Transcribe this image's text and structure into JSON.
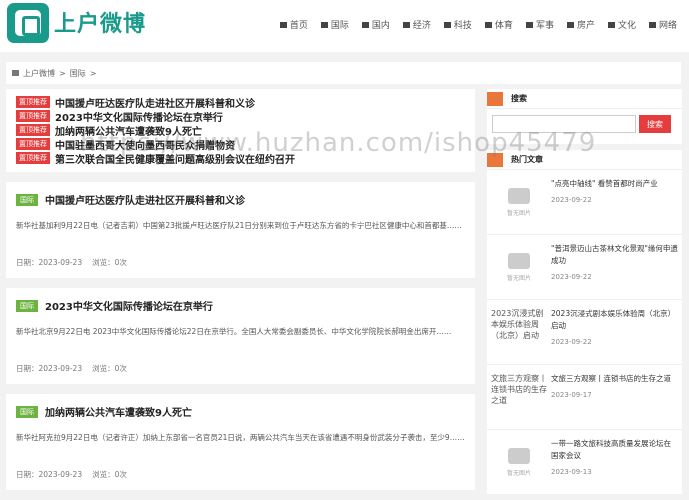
{
  "site": {
    "logo_text": "上户微博"
  },
  "nav": [
    "首页",
    "国际",
    "国内",
    "经济",
    "科技",
    "体育",
    "军事",
    "房产",
    "文化",
    "网络"
  ],
  "breadcrumb": [
    "上户微博",
    ">",
    "国际",
    ">"
  ],
  "hot": {
    "badge": "置顶推荐",
    "items": [
      "中国援卢旺达医疗队走进社区开展科普和义诊",
      "2023中华文化国际传播论坛在京举行",
      "加纳两辆公共汽车遭袭致9人死亡",
      "中国驻墨西哥大使向墨西哥民众捐赠物资",
      "第三次联合国全民健康覆盖问题高级别会议在纽约召开"
    ]
  },
  "posts": [
    {
      "badge": "国际",
      "title": "中国援卢旺达医疗队走进社区开展科普和义诊",
      "excerpt": "新华社基加利9月22日电（记者吉莉）中国第23批援卢旺达医疗队21日分别来到位于卢旺达东方省的卡宁巴社区健康中心和首都基……",
      "date": "日期：2023-09-23",
      "views": "浏览：0次"
    },
    {
      "badge": "国际",
      "title": "2023中华文化国际传播论坛在京举行",
      "excerpt": "新华社北京9月22日电 2023中华文化国际传播论坛22日在京举行。全国人大常委会副委员长、中华文化学院院长郝明金出席开……",
      "date": "日期：2023-09-23",
      "views": "浏览：0次"
    },
    {
      "badge": "国际",
      "title": "加纳两辆公共汽车遭袭致9人死亡",
      "excerpt": "新华社阿克拉9月22日电（记者许正）加纳上东部省一名官员21日说，两辆公共汽车当天在该省遭遇不明身份武装分子袭击，至少9……",
      "date": "日期：2023-09-23",
      "views": "浏览：0次"
    }
  ],
  "sidebar": {
    "search_title": "搜索",
    "search_btn": "搜索",
    "hot_title": "热门文章",
    "no_img": "暂无图片",
    "articles": [
      {
        "title": "\"点亮中轴线\" 看赞首都时尚产业",
        "date": "2023-09-22",
        "thumb": ""
      },
      {
        "title": "\"普洱景迈山古茶林文化景观\"缘何申遗成功",
        "date": "2023-09-22",
        "thumb": ""
      },
      {
        "title": "2023沉浸式剧本娱乐体验周（北京）启动",
        "date": "2023-09-22",
        "thumb": "2023沉浸式剧本娱乐体验周（北京）启动"
      },
      {
        "title": "文旅三方观察丨连锁书店的生存之道",
        "date": "2023-09-17",
        "thumb": "文旅三方观察丨连锁书店的生存之道"
      },
      {
        "title": "一带一路文旅科技高质量发展论坛在国家会议",
        "date": "2023-09-13",
        "thumb": ""
      }
    ]
  },
  "watermark": "https://www.huzhan.com/ishop45479"
}
